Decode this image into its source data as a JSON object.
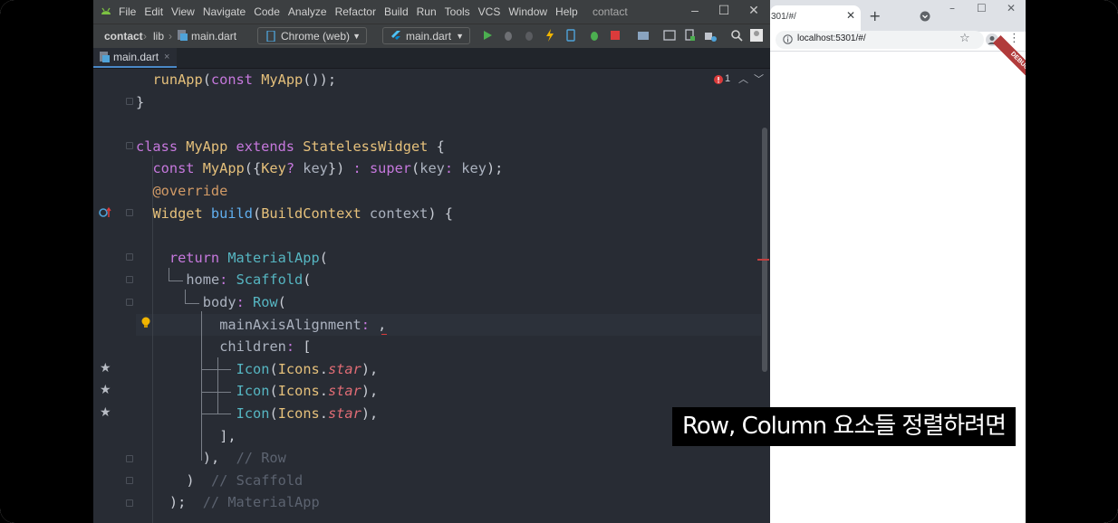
{
  "ide": {
    "menu": [
      "File",
      "Edit",
      "View",
      "Navigate",
      "Code",
      "Analyze",
      "Refactor",
      "Build",
      "Run",
      "Tools",
      "VCS",
      "Window",
      "Help"
    ],
    "project_title": "contact",
    "window_controls": {
      "minimize": "–",
      "maximize": "☐",
      "close": "✕"
    },
    "breadcrumbs": {
      "project": "contact",
      "folder": "lib",
      "file": "main.dart"
    },
    "device_selector": "Chrome (web)",
    "run_config": "main.dart",
    "tab_label": "main.dart",
    "tab_close": "×",
    "error_count": "1",
    "code_lines": [
      {
        "indent": "  ",
        "tokens": [
          {
            "t": "runApp",
            "c": "cls"
          },
          {
            "t": "(",
            "c": "plain"
          },
          {
            "t": "const ",
            "c": "kw"
          },
          {
            "t": "MyApp",
            "c": "cls"
          },
          {
            "t": "());",
            "c": "plain"
          }
        ]
      },
      {
        "indent": "",
        "tokens": [
          {
            "t": "}",
            "c": "plain"
          }
        ]
      },
      {
        "indent": "",
        "tokens": []
      },
      {
        "indent": "",
        "tokens": [
          {
            "t": "class ",
            "c": "kw"
          },
          {
            "t": "MyApp ",
            "c": "cls"
          },
          {
            "t": "extends ",
            "c": "kw"
          },
          {
            "t": "StatelessWidget ",
            "c": "cls"
          },
          {
            "t": "{",
            "c": "plain"
          }
        ]
      },
      {
        "indent": "  ",
        "tokens": [
          {
            "t": "const ",
            "c": "kw"
          },
          {
            "t": "MyApp",
            "c": "cls"
          },
          {
            "t": "({",
            "c": "plain"
          },
          {
            "t": "Key",
            "c": "cls"
          },
          {
            "t": "? ",
            "c": "kw"
          },
          {
            "t": "key",
            "c": "prm"
          },
          {
            "t": "}) ",
            "c": "plain"
          },
          {
            "t": ": ",
            "c": "kw"
          },
          {
            "t": "super",
            "c": "kw"
          },
          {
            "t": "(",
            "c": "plain"
          },
          {
            "t": "key",
            "c": "prm"
          },
          {
            "t": ": ",
            "c": "kw"
          },
          {
            "t": "key",
            "c": "prm"
          },
          {
            "t": ");",
            "c": "plain"
          }
        ]
      },
      {
        "indent": "  ",
        "tokens": [
          {
            "t": "@override",
            "c": "ann"
          }
        ]
      },
      {
        "indent": "  ",
        "tokens": [
          {
            "t": "Widget ",
            "c": "cls"
          },
          {
            "t": "build",
            "c": "fn"
          },
          {
            "t": "(",
            "c": "plain"
          },
          {
            "t": "BuildContext ",
            "c": "cls"
          },
          {
            "t": "context",
            "c": "prm"
          },
          {
            "t": ") {",
            "c": "plain"
          }
        ]
      },
      {
        "indent": "",
        "tokens": []
      },
      {
        "indent": "    ",
        "tokens": [
          {
            "t": "return ",
            "c": "kw"
          },
          {
            "t": "MaterialApp",
            "c": "type"
          },
          {
            "t": "(",
            "c": "plain"
          }
        ]
      },
      {
        "indent": "      ",
        "tokens": [
          {
            "t": "home",
            "c": "prm"
          },
          {
            "t": ": ",
            "c": "kw"
          },
          {
            "t": "Scaffold",
            "c": "type"
          },
          {
            "t": "(",
            "c": "plain"
          }
        ]
      },
      {
        "indent": "        ",
        "tokens": [
          {
            "t": "body",
            "c": "prm"
          },
          {
            "t": ": ",
            "c": "kw"
          },
          {
            "t": "Row",
            "c": "type"
          },
          {
            "t": "(",
            "c": "plain"
          }
        ]
      },
      {
        "indent": "          ",
        "tokens": [
          {
            "t": "mainAxisAlignment",
            "c": "prm"
          },
          {
            "t": ": ",
            "c": "kw"
          },
          {
            "t": ",",
            "c": "plain"
          }
        ]
      },
      {
        "indent": "          ",
        "tokens": [
          {
            "t": "children",
            "c": "prm"
          },
          {
            "t": ": ",
            "c": "kw"
          },
          {
            "t": "[",
            "c": "plain"
          }
        ]
      },
      {
        "indent": "            ",
        "tokens": [
          {
            "t": "Icon",
            "c": "type"
          },
          {
            "t": "(",
            "c": "plain"
          },
          {
            "t": "Icons",
            "c": "cls"
          },
          {
            "t": ".",
            "c": "plain"
          },
          {
            "t": "star",
            "c": "itl"
          },
          {
            "t": "),",
            "c": "plain"
          }
        ]
      },
      {
        "indent": "            ",
        "tokens": [
          {
            "t": "Icon",
            "c": "type"
          },
          {
            "t": "(",
            "c": "plain"
          },
          {
            "t": "Icons",
            "c": "cls"
          },
          {
            "t": ".",
            "c": "plain"
          },
          {
            "t": "star",
            "c": "itl"
          },
          {
            "t": "),",
            "c": "plain"
          }
        ]
      },
      {
        "indent": "            ",
        "tokens": [
          {
            "t": "Icon",
            "c": "type"
          },
          {
            "t": "(",
            "c": "plain"
          },
          {
            "t": "Icons",
            "c": "cls"
          },
          {
            "t": ".",
            "c": "plain"
          },
          {
            "t": "star",
            "c": "itl"
          },
          {
            "t": "),",
            "c": "plain"
          }
        ]
      },
      {
        "indent": "          ",
        "tokens": [
          {
            "t": "],",
            "c": "plain"
          }
        ]
      },
      {
        "indent": "        ",
        "tokens": [
          {
            "t": "),  ",
            "c": "plain"
          },
          {
            "t": "// Row",
            "c": "cmt"
          }
        ]
      },
      {
        "indent": "      ",
        "tokens": [
          {
            "t": ")  ",
            "c": "plain"
          },
          {
            "t": "// Scaffold",
            "c": "cmt"
          }
        ]
      },
      {
        "indent": "    ",
        "tokens": [
          {
            "t": ");  ",
            "c": "plain"
          },
          {
            "t": "// MaterialApp",
            "c": "cmt"
          }
        ]
      }
    ]
  },
  "browser": {
    "tab_title": "301/#/",
    "tab_close": "✕",
    "new_tab": "+",
    "url": "localhost:5301/#/",
    "debug_banner": "DEBUG"
  },
  "subtitle": "Row, Column 요소들 정렬하려면"
}
